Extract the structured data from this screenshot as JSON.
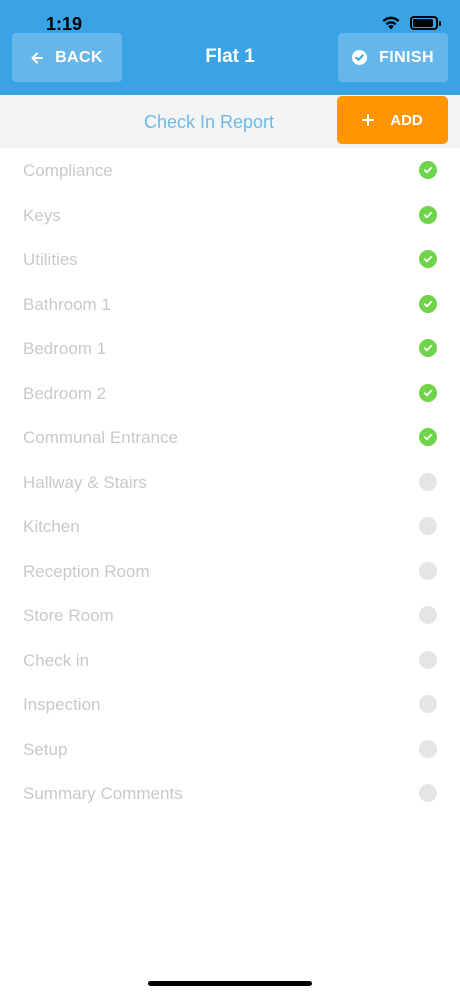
{
  "status_bar": {
    "time": "1:19"
  },
  "header": {
    "back_label": "BACK",
    "title": "Flat 1",
    "finish_label": "FINISH"
  },
  "subbar": {
    "title": "Check In Report",
    "add_label": "ADD"
  },
  "items": [
    {
      "label": "Compliance",
      "done": true
    },
    {
      "label": "Keys",
      "done": true
    },
    {
      "label": "Utilities",
      "done": true
    },
    {
      "label": "Bathroom 1",
      "done": true
    },
    {
      "label": "Bedroom 1",
      "done": true
    },
    {
      "label": "Bedroom 2",
      "done": true
    },
    {
      "label": "Communal Entrance",
      "done": true
    },
    {
      "label": "Hallway & Stairs",
      "done": false
    },
    {
      "label": "Kitchen",
      "done": false
    },
    {
      "label": "Reception Room",
      "done": false
    },
    {
      "label": "Store Room",
      "done": false
    },
    {
      "label": "Check in",
      "done": false
    },
    {
      "label": "Inspection",
      "done": false
    },
    {
      "label": "Setup",
      "done": false
    },
    {
      "label": "Summary Comments",
      "done": false
    }
  ],
  "colors": {
    "header": "#3aa3e6",
    "add_button": "#ff9500",
    "done": "#6ed44a",
    "pending": "#e5e5e5"
  }
}
